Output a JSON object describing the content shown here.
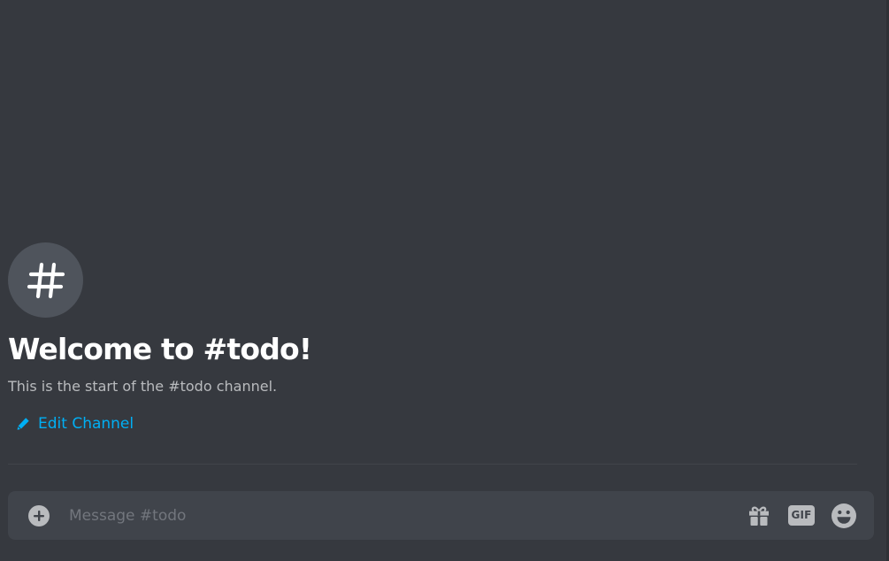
{
  "channel": {
    "icon": "hash-icon",
    "welcome_title": "Welcome to #todo!",
    "welcome_subtitle": "This is the start of the #todo channel.",
    "edit_label": "Edit Channel",
    "edit_icon": "pencil-icon"
  },
  "composer": {
    "placeholder": "Message #todo",
    "value": "",
    "add_icon": "plus-circle-icon",
    "gift_icon": "gift-icon",
    "gif_label": "GIF",
    "emoji_icon": "emoji-icon"
  },
  "colors": {
    "background": "#36393f",
    "composer_bg": "#40444b",
    "link": "#00aff4",
    "heading": "#ffffff",
    "muted": "#b9bbbe"
  }
}
